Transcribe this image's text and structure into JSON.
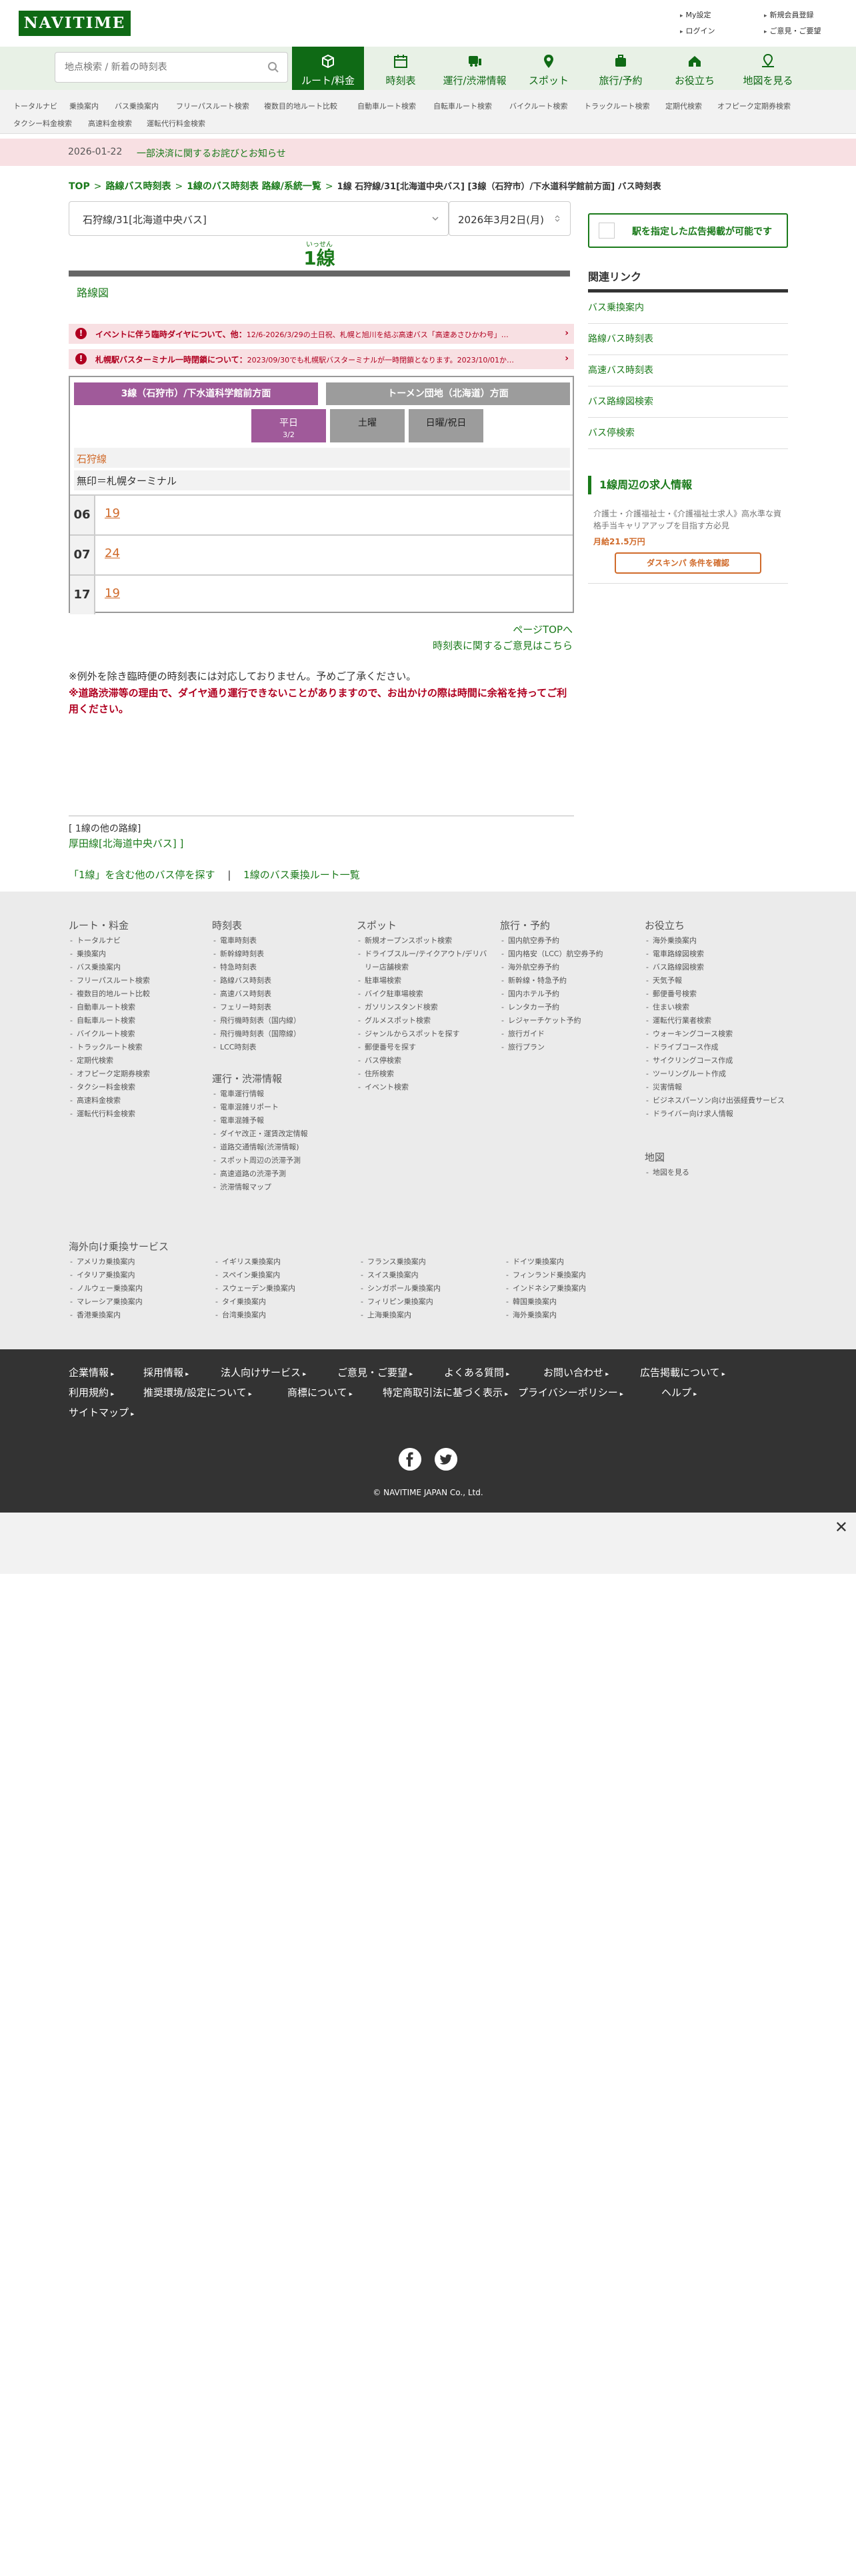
{
  "header": {
    "logo": "NAVITIME",
    "links": [
      "My設定",
      "新規会員登録",
      "ログイン",
      "ご意見・ご要望"
    ]
  },
  "search": {
    "placeholder": "地点検索 / 新着の時刻表"
  },
  "nav": {
    "tabs": [
      {
        "label": "ルート/料金",
        "icon": "route-icon",
        "active": true
      },
      {
        "label": "時刻表",
        "icon": "timetable-icon"
      },
      {
        "label": "運行/渋滞情報",
        "icon": "traffic-icon"
      },
      {
        "label": "スポット",
        "icon": "spot-pin-icon"
      },
      {
        "label": "旅行/予約",
        "icon": "suitcase-icon"
      },
      {
        "label": "お役立ち",
        "icon": "house-icon"
      },
      {
        "label": "地図を見る",
        "icon": "map-icon"
      }
    ]
  },
  "subnav": {
    "items": [
      "トータルナビ",
      "乗換案内",
      "バス乗換案内",
      "フリーパスルート検索",
      "複数目的地ルート比較",
      "自動車ルート検索",
      "自転車ルート検索",
      "バイクルート検索",
      "トラックルート検索",
      "定期代検索",
      "オフピーク定期券検索",
      "タクシー料金検索",
      "高速料金検索",
      "運転代行料金検索"
    ]
  },
  "notice": {
    "date": "2026-01-22",
    "text": "一部決済に関するお詫びとお知らせ"
  },
  "breadcrumb": {
    "items": [
      "TOP",
      "路線バス時刻表",
      "1線のバス時刻表 路線/系統一覧"
    ],
    "current": "1線 石狩線/31[北海道中央バス] [3線（石狩市）/下水道科学館前方面] バス時刻表"
  },
  "main": {
    "route_select": "石狩線/31[北海道中央バス]",
    "date_select": "2026年3月2日(月)",
    "line_ruby": "いっせん",
    "line_title": "1線",
    "route_map": "路線図",
    "alerts": [
      {
        "head": "イベントに伴う臨時ダイヤについて、他",
        "body": "12/6-2026/3/29の土日祝、札幌と旭川を結ぶ高速バス「高速あさひかわ号」…"
      },
      {
        "head": "札幌駅バスターミナル一時閉鎖について",
        "body": "2023/09/30でも札幌駅バスターミナルが一時閉鎖となります。2023/10/01か…"
      }
    ],
    "directions": [
      "3線（石狩市）/下水道科学館前方面",
      "トーメン団地（北海道）方面"
    ],
    "days": [
      {
        "label": "平日",
        "sub": "3/2"
      },
      {
        "label": "土曜",
        "sub": ""
      },
      {
        "label": "日曜/祝日",
        "sub": ""
      }
    ],
    "stop_name": "石狩線",
    "legend": "無印＝札幌ターミナル",
    "rows": [
      {
        "hour": "06",
        "minutes": "19"
      },
      {
        "hour": "07",
        "minutes": "24"
      },
      {
        "hour": "17",
        "minutes": "19"
      }
    ],
    "page_top": "ページTOPへ",
    "opinion": "時刻表に関するご意見はこちら",
    "note1": "※例外を除き臨時便の時刻表には対応しておりません。予めご了承ください。",
    "note2": "※道路渋滞等の理由で、ダイヤ通り運行できないことがありますので、お出かけの際は時間に余裕を持ってご利用ください。",
    "other_head": "[ 1線の他の路線]",
    "other_link": "厚田線[北海道中央バス] ]",
    "bottom_links": [
      "「1線」を含む他のバス停を探す",
      "1線のバス乗換ルート一覧"
    ]
  },
  "sidebar": {
    "ad_button": "駅を指定した広告掲載が可能です",
    "related_head": "関連リンク",
    "related": [
      "バス乗換案内",
      "路線バス時刻表",
      "高速バス時刻表",
      "バス路線図検索",
      "バス停検索"
    ],
    "job_head": "1線周辺の求人情報",
    "job_body": "介護士・介護福祉士・《介護福祉士求人》高水準な資格手当キャリアアップを目指す方必見",
    "job_salary": "月給21.5万円",
    "job_button": "ダスキンパ 条件を確認"
  },
  "footer_map": {
    "cols": [
      {
        "head": "ルート・料金",
        "items": [
          "トータルナビ",
          "乗換案内",
          "バス乗換案内",
          "フリーパスルート検索",
          "複数目的地ルート比較",
          "自動車ルート検索",
          "自転車ルート検索",
          "バイクルート検索",
          "トラックルート検索",
          "定期代検索",
          "オフピーク定期券検索",
          "タクシー料金検索",
          "高速料金検索",
          "運転代行料金検索"
        ]
      },
      {
        "head": "時刻表",
        "items": [
          "電車時刻表",
          "新幹線時刻表",
          "特急時刻表",
          "路線バス時刻表",
          "高速バス時刻表",
          "フェリー時刻表",
          "飛行機時刻表（国内線）",
          "飛行機時刻表（国際線）",
          "LCC時刻表"
        ]
      },
      {
        "head": "運行・渋滞情報",
        "items": [
          "電車運行情報",
          "電車混雑リポート",
          "電車混雑予報",
          "ダイヤ改正・運賃改定情報",
          "道路交通情報(渋滞情報)",
          "スポット周辺の渋滞予測",
          "高速道路の渋滞予測",
          "渋滞情報マップ"
        ]
      },
      {
        "head": "スポット",
        "items": [
          "新規オープンスポット検索",
          "ドライブスルー/テイクアウト/デリバリー店舗検索",
          "駐車場検索",
          "バイク駐車場検索",
          "ガソリンスタンド検索",
          "グルメスポット検索",
          "ジャンルからスポットを探す",
          "郵便番号を探す",
          "バス停検索",
          "住所検索",
          "イベント検索"
        ]
      },
      {
        "head": "旅行・予約",
        "items": [
          "国内航空券予約",
          "国内格安（LCC）航空券予約",
          "海外航空券予約",
          "新幹線・特急予約",
          "国内ホテル予約",
          "レンタカー予約",
          "レジャーチケット予約",
          "旅行ガイド",
          "旅行プラン"
        ]
      },
      {
        "head": "お役立ち",
        "items": [
          "海外乗換案内",
          "電車路線図検索",
          "バス路線図検索",
          "天気予報",
          "郵便番号検索",
          "住まい検索",
          "運転代行業者検索",
          "ウォーキングコース検索",
          "ドライブコース作成",
          "サイクリングコース作成",
          "ツーリングルート作成",
          "災害情報",
          "ビジネスパーソン向け出張経費サービス",
          "ドライバー向け求人情報"
        ]
      },
      {
        "head": "地図",
        "items": [
          "地図を見る"
        ]
      }
    ],
    "overseas_head": "海外向け乗換サービス",
    "overseas": [
      "アメリカ乗換案内",
      "イギリス乗換案内",
      "フランス乗換案内",
      "ドイツ乗換案内",
      "イタリア乗換案内",
      "スペイン乗換案内",
      "スイス乗換案内",
      "フィンランド乗換案内",
      "ノルウェー乗換案内",
      "スウェーデン乗換案内",
      "シンガポール乗換案内",
      "インドネシア乗換案内",
      "マレーシア乗換案内",
      "タイ乗換案内",
      "フィリピン乗換案内",
      "韓国乗換案内",
      "香港乗換案内",
      "台湾乗換案内",
      "上海乗換案内",
      "海外乗換案内"
    ]
  },
  "footer": {
    "links_row1": [
      "企業情報",
      "採用情報",
      "法人向けサービス",
      "ご意見・ご要望",
      "よくある質問",
      "お問い合わせ",
      "広告掲載について"
    ],
    "links_row2": [
      "利用規約",
      "推奨環境/設定について",
      "商標について",
      "特定商取引法に基づく表示",
      "プライバシーポリシー",
      "ヘルプ"
    ],
    "links_row3": [
      "サイトマップ"
    ],
    "sns": [
      "facebook-icon",
      "twitter-icon"
    ],
    "copyright": "© NAVITIME JAPAN Co., Ltd."
  },
  "colors": {
    "brand": "#0f6a15",
    "link": "#1a7a1a",
    "alert": "#b00020",
    "direction_active": "#a05a9a",
    "minute": "#d06a2a"
  }
}
